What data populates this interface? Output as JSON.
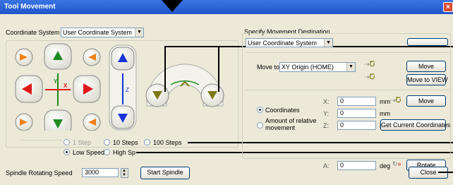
{
  "window": {
    "title": "Tool Movement",
    "close_glyph": "×"
  },
  "coordinate_system": {
    "label": "Coordinate System",
    "value": "User Coordinate System"
  },
  "destination": {
    "group_label": "Specify Movement Destination",
    "select_value": "User Coordinate System",
    "move_to_label": "Move to",
    "move_to_value": "XY Origin (HOME)",
    "move_button": "Move",
    "move_to_view_button": "Move to VIEW",
    "mode_coordinates": "Coordinates",
    "mode_relative_1": "Amount of relative",
    "mode_relative_2": "movement",
    "x_label": "X:",
    "x_value": "0",
    "x_unit": "mm",
    "y_label": "Y:",
    "y_value": "0",
    "y_unit": "mm",
    "z_label": "Z:",
    "z_value": "0",
    "z_unit": "mm",
    "coord_move_button": "Move",
    "get_current_button": "Get Current Coordinates",
    "a_label": "A:",
    "a_value": "0",
    "a_unit": "deg",
    "rotate_button": "Rotate"
  },
  "jog": {
    "axis_y": "Y",
    "axis_x": "X",
    "axis_z": "Z"
  },
  "steps": {
    "one": "1 Step",
    "ten": "10 Steps",
    "hundred": "100 Steps",
    "selected": "none"
  },
  "speed": {
    "low": "Low Speed",
    "high": "High Sp",
    "selected": "low"
  },
  "spindle": {
    "label": "Spindle Rotating Speed",
    "value": "3000",
    "start_button": "Start Spindle"
  },
  "footer": {
    "close_button": "Close"
  },
  "colors": {
    "green": "#1f8a1f",
    "red": "#e01818",
    "blue": "#1833d8",
    "orange": "#f0801a",
    "olive": "#7a7a12"
  }
}
